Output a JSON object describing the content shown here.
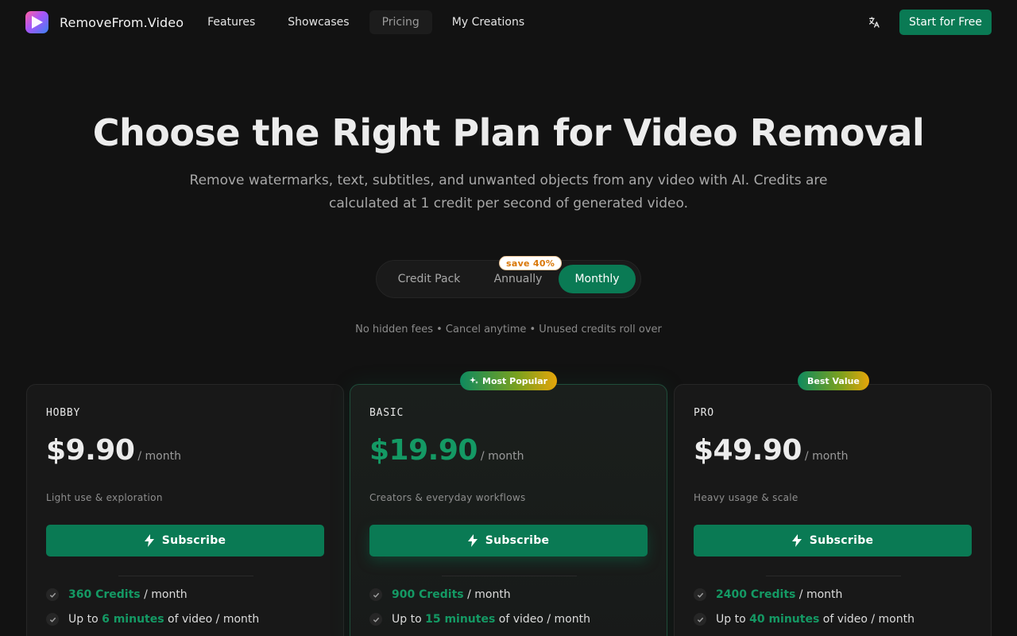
{
  "nav": {
    "brand": "RemoveFrom.Video",
    "links": [
      {
        "label": "Features",
        "active": false
      },
      {
        "label": "Showcases",
        "active": false
      },
      {
        "label": "Pricing",
        "active": true
      },
      {
        "label": "My Creations",
        "active": false
      }
    ],
    "language_icon": "translate-icon",
    "cta_label": "Start for Free"
  },
  "hero": {
    "title": "Choose the Right Plan for Video Removal",
    "subtitle": "Remove watermarks, text, subtitles, and unwanted objects from any video with AI. Credits are calculated at 1 credit per second of generated video."
  },
  "billing_toggle": {
    "options": [
      "Credit Pack",
      "Annually",
      "Monthly"
    ],
    "selected": "Monthly",
    "annual_badge": "save 40%"
  },
  "note": "No hidden fees • Cancel anytime • Unused credits roll over",
  "plans": [
    {
      "name": "HOBBY",
      "price": "$9.90",
      "period": "/ month",
      "description": "Light use & exploration",
      "button": "Subscribe",
      "badge": "",
      "features": [
        {
          "highlight": "360 Credits",
          "pre": "",
          "post": " / month"
        },
        {
          "pre": "Up to ",
          "highlight": "6 minutes",
          "post": " of video / month"
        }
      ]
    },
    {
      "name": "BASIC",
      "price": "$19.90",
      "period": "/ month",
      "description": "Creators & everyday workflows",
      "button": "Subscribe",
      "badge": "Most Popular",
      "features": [
        {
          "highlight": "900 Credits",
          "pre": "",
          "post": " / month"
        },
        {
          "pre": "Up to ",
          "highlight": "15 minutes",
          "post": " of video / month"
        }
      ]
    },
    {
      "name": "PRO",
      "price": "$49.90",
      "period": "/ month",
      "description": "Heavy usage & scale",
      "button": "Subscribe",
      "badge": "Best Value",
      "features": [
        {
          "highlight": "2400 Credits",
          "pre": "",
          "post": " / month"
        },
        {
          "pre": "Up to ",
          "highlight": "40 minutes",
          "post": " of video / month"
        }
      ]
    }
  ],
  "colors": {
    "background": "#121212",
    "accent": "#0a7a54",
    "accent_text": "#149964",
    "badge_orange": "#d97706"
  }
}
